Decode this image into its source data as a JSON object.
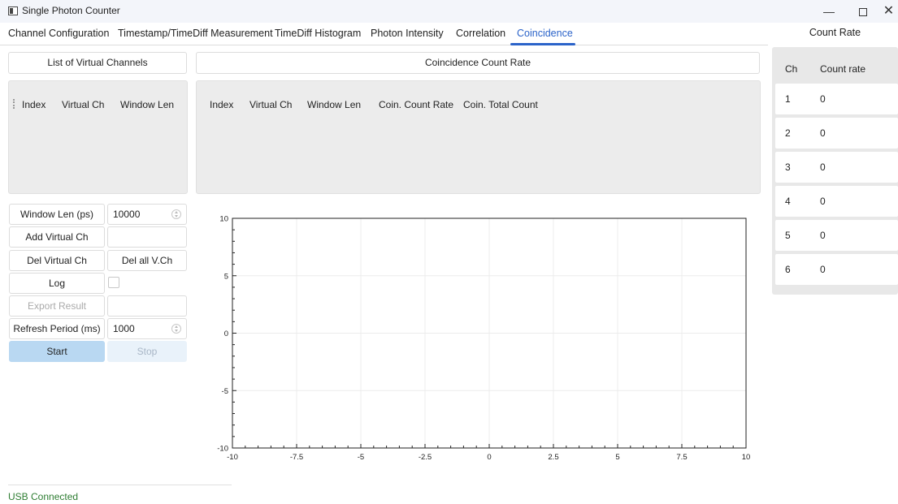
{
  "window": {
    "title": "Single Photon Counter",
    "minimize": "—",
    "close": "✕"
  },
  "tabs": [
    {
      "label": "Channel Configuration",
      "active": false
    },
    {
      "label": "Timestamp/TimeDiff Measurement",
      "active": false
    },
    {
      "label": "TimeDiff Histogram",
      "active": false
    },
    {
      "label": "Photon Intensity",
      "active": false
    },
    {
      "label": "Correlation",
      "active": false
    },
    {
      "label": "Coincidence",
      "active": true
    }
  ],
  "left": {
    "list_title": "List of Virtual Channels",
    "columns": [
      "Index",
      "Virtual Ch",
      "Window Len"
    ],
    "window_len_label": "Window Len (ps)",
    "window_len_value": "10000",
    "add_label": "Add Virtual Ch",
    "del_label": "Del Virtual Ch",
    "del_all_label": "Del all V.Ch",
    "log_label": "Log",
    "export_label": "Export Result",
    "refresh_label": "Refresh Period (ms)",
    "refresh_value": "1000",
    "start_label": "Start",
    "stop_label": "Stop"
  },
  "coincidence": {
    "title": "Coincidence Count Rate",
    "columns": [
      "Index",
      "Virtual Ch",
      "Window Len",
      "Coin. Count Rate",
      "Coin. Total Count"
    ]
  },
  "chart_data": {
    "type": "line",
    "series": [],
    "xlim": [
      -10,
      10
    ],
    "ylim": [
      -10,
      10
    ],
    "xticks": [
      "-10",
      "-7.5",
      "-5",
      "-2.5",
      "0",
      "2.5",
      "5",
      "7.5",
      "10"
    ],
    "yticks": [
      "10",
      "5",
      "0",
      "-5",
      "-10"
    ],
    "grid": true
  },
  "count_rate": {
    "title": "Count Rate",
    "col_ch": "Ch",
    "col_rate": "Count rate",
    "rows": [
      {
        "ch": "1",
        "rate": "0"
      },
      {
        "ch": "2",
        "rate": "0"
      },
      {
        "ch": "3",
        "rate": "0"
      },
      {
        "ch": "4",
        "rate": "0"
      },
      {
        "ch": "5",
        "rate": "0"
      },
      {
        "ch": "6",
        "rate": "0"
      }
    ]
  },
  "status": {
    "text": "USB Connected",
    "color": "#2e7d32"
  },
  "colors": {
    "accent": "#2b63c9",
    "primary_button": "#b9d8f2"
  }
}
